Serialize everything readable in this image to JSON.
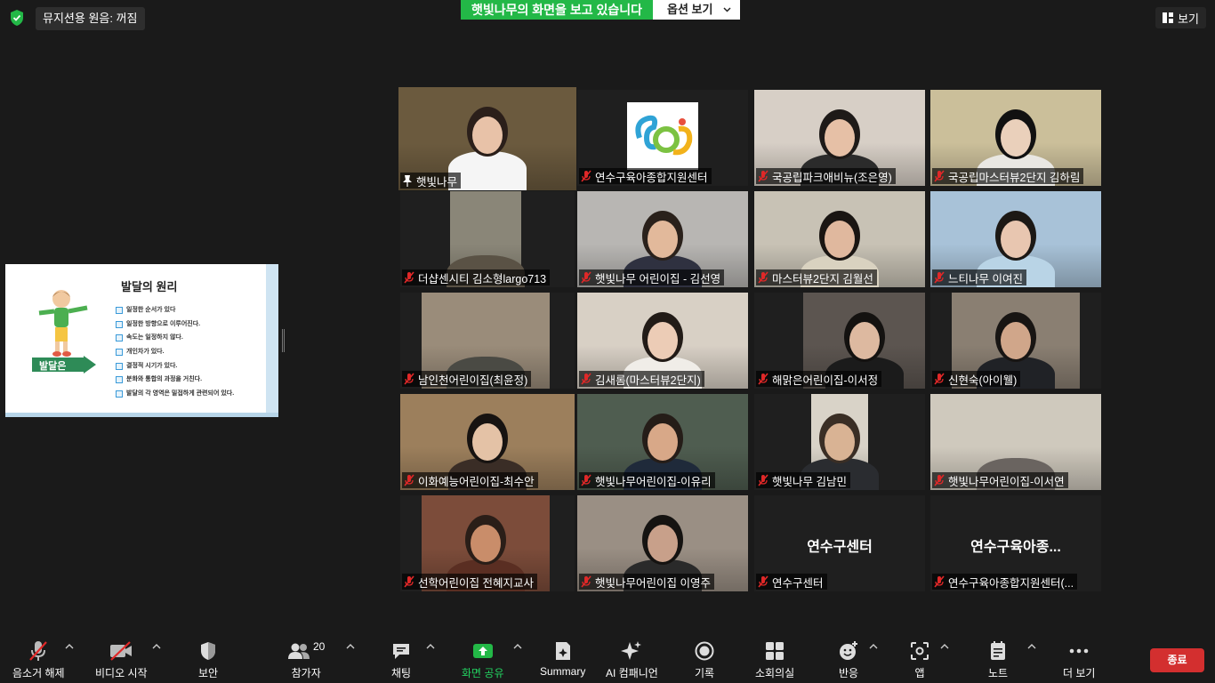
{
  "top": {
    "audio_label": "뮤지션용 원음: 꺼짐",
    "share_banner": "햇빛나무의 화면을 보고 있습니다",
    "options_label": "옵션 보기",
    "view_label": "보기"
  },
  "slide": {
    "title": "발달의 원리",
    "arrow_label": "발달은",
    "items": [
      "일정한 순서가 있다",
      "일정한 방향으로 이루어진다.",
      "속도는 일정하지 않다.",
      "개인차가 있다.",
      "결정적 시기가 있다.",
      "분화와 통합의 과정을 거친다.",
      "발달의 각 영역은 밀접하게 관련되어 있다."
    ]
  },
  "participants": [
    {
      "name": "햇빛나무",
      "active": true,
      "muted": false
    },
    {
      "name": "연수구육아종합지원센터",
      "muted": true
    },
    {
      "name": "국공립파크애비뉴(조은영)",
      "muted": true
    },
    {
      "name": "국공립마스터뷰2단지 김하림",
      "muted": true
    },
    {
      "name": "더샵센시티 김소형largo713",
      "muted": true
    },
    {
      "name": "햇빛나무 어린이집 - 김선영",
      "muted": true
    },
    {
      "name": "마스터뷰2단지 김월선",
      "muted": true
    },
    {
      "name": "느티나무 이여진",
      "muted": true
    },
    {
      "name": "남인천어린이집(최윤정)",
      "muted": true
    },
    {
      "name": "김새롬(마스터뷰2단지)",
      "muted": true
    },
    {
      "name": "해맑은어린이집-이서정",
      "muted": true
    },
    {
      "name": "신현숙(아이웰)",
      "muted": true
    },
    {
      "name": "이화예능어린이집-최수안",
      "muted": true
    },
    {
      "name": "햇빛나무어린이집-이유리",
      "muted": true
    },
    {
      "name": "햇빛나무 김남민",
      "muted": true
    },
    {
      "name": "햇빛나무어린이집-이서연",
      "muted": true
    },
    {
      "name": "선학어린이집 전혜지교사",
      "muted": true
    },
    {
      "name": "햇빛나무어린이집 이영주",
      "muted": true
    },
    {
      "name": "연수구센터",
      "muted": true,
      "video_label": "연수구센터"
    },
    {
      "name": "연수구육아종합지원센터(...",
      "muted": true,
      "video_label": "연수구육아종..."
    }
  ],
  "toolbar": {
    "unmute": "음소거 해제",
    "video": "비디오 시작",
    "security": "보안",
    "participants": "참가자",
    "participants_count": "20",
    "chat": "채팅",
    "share": "화면 공유",
    "summary": "Summary",
    "ai": "AI 컴패니언",
    "record": "기록",
    "breakout": "소회의실",
    "reactions": "반응",
    "apps": "앱",
    "notes": "노트",
    "more": "더 보기",
    "end": "종료"
  },
  "colors": {
    "share_green": "#23b847",
    "end_red": "#d32f2f",
    "active_border": "#e5e545",
    "muted_red": "#e02828"
  }
}
